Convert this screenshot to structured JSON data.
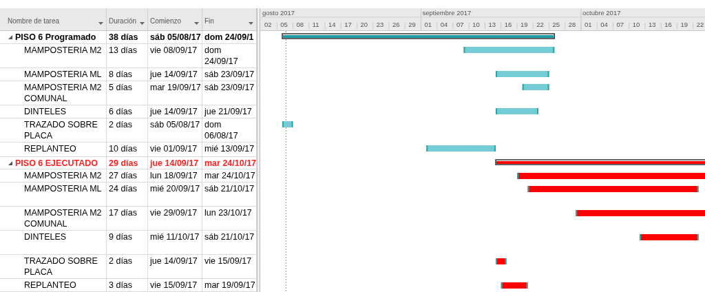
{
  "columns": [
    {
      "label": "Nombre de tarea"
    },
    {
      "label": "Duración"
    },
    {
      "label": "Comienzo"
    },
    {
      "label": "Fin"
    }
  ],
  "tasks": [
    {
      "name": "PISO 6 Programado",
      "duration": "38 días",
      "start": "sáb 05/08/17",
      "finish": "dom 24/09/1",
      "expanded": true,
      "highlight": false,
      "color": "#1f9ca6",
      "children": [
        {
          "name": "MAMPOSTERIA M2",
          "duration": "13 días",
          "start": "vie 08/09/17",
          "finish": "dom 24/09/17",
          "color": "#74ccd5"
        },
        {
          "name": "MAMPOSTERIA ML",
          "duration": "8 días",
          "start": "jue 14/09/17",
          "finish": "sáb 23/09/17",
          "color": "#74ccd5"
        },
        {
          "name": "MAMPOSTERIA M2 COMUNAL",
          "duration": "5 días",
          "start": "mar 19/09/17",
          "finish": "sáb 23/09/17",
          "color": "#74ccd5"
        },
        {
          "name": "DINTELES",
          "duration": "6 días",
          "start": "jue 14/09/17",
          "finish": "jue 21/09/17",
          "color": "#74ccd5"
        },
        {
          "name": "TRAZADO SOBRE PLACA",
          "duration": "2 días",
          "start": "sáb 05/08/17",
          "finish": "dom 06/08/17",
          "color": "#74ccd5"
        },
        {
          "name": "REPLANTEO",
          "duration": "10 días",
          "start": "vie 01/09/17",
          "finish": "mié 13/09/17",
          "color": "#74ccd5"
        }
      ]
    },
    {
      "name": "PISO 6 EJECUTADO",
      "duration": "29 días",
      "start": "jue 14/09/17",
      "finish": "mar 24/10/17",
      "expanded": true,
      "highlight": true,
      "color": "#ff0000",
      "children": [
        {
          "name": "MAMPOSTERIA M2",
          "duration": "27 días",
          "start": "lun 18/09/17",
          "finish": "mar 24/10/17",
          "color": "#ff0000"
        },
        {
          "name": "MAMPOSTERIA ML",
          "duration": "24 días",
          "start": "mié 20/09/17",
          "finish": "sáb 21/10/17",
          "color": "#ff0000"
        },
        {
          "name": "MAMPOSTERIA M2 COMUNAL",
          "duration": "17 días",
          "start": "vie 29/09/17",
          "finish": "lun 23/10/17",
          "color": "#ff0000"
        },
        {
          "name": "DINTELES",
          "duration": "9 días",
          "start": "mié 11/10/17",
          "finish": "sáb 21/10/17",
          "color": "#ff0000"
        },
        {
          "name": "TRAZADO SOBRE PLACA",
          "duration": "2 días",
          "start": "jue 14/09/17",
          "finish": "vie 15/09/17",
          "color": "#ff0000"
        },
        {
          "name": "REPLANTEO",
          "duration": "3 días",
          "start": "vie 15/09/17",
          "finish": "mar 19/09/17",
          "color": "#ff0000"
        }
      ]
    }
  ],
  "timescale": {
    "months": [
      {
        "label": "gosto 2017"
      },
      {
        "label": "septiembre 2017"
      },
      {
        "label": "octubre 2017"
      }
    ],
    "days": [
      {
        "label": "02"
      },
      {
        "label": "05"
      },
      {
        "label": "08"
      },
      {
        "label": "11"
      },
      {
        "label": "14"
      },
      {
        "label": "17"
      },
      {
        "label": "20"
      },
      {
        "label": "23"
      },
      {
        "label": "26"
      },
      {
        "label": "29"
      },
      {
        "label": "01"
      },
      {
        "label": "04"
      },
      {
        "label": "07"
      },
      {
        "label": "10"
      },
      {
        "label": "13"
      },
      {
        "label": "16"
      },
      {
        "label": "19"
      },
      {
        "label": "22"
      },
      {
        "label": "25"
      },
      {
        "label": "28"
      },
      {
        "label": "01"
      },
      {
        "label": "04"
      },
      {
        "label": "07"
      },
      {
        "label": "10"
      },
      {
        "label": "13"
      },
      {
        "label": "16"
      },
      {
        "label": "19"
      },
      {
        "label": "22"
      }
    ]
  }
}
